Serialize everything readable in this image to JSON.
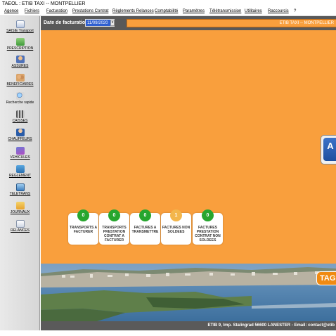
{
  "window": {
    "title": "TAEOL : ETIB TAXI -- MONTPELLIER"
  },
  "menu": [
    "Agence",
    "Fichiers",
    "Facturation",
    "Prestations Contrat",
    "Règlements Relances",
    "Comptabilité",
    "Paramètres",
    "Télétransmission",
    "Utilitaires",
    "Raccourcis",
    "?"
  ],
  "sidebar": [
    {
      "label": "SAISIE Transport",
      "icon": "ambulance-icon"
    },
    {
      "label": "PRESCRIPTION",
      "icon": "prescription-icon"
    },
    {
      "label": "ASSURES",
      "icon": "insured-icon"
    },
    {
      "label": "BENEFICIAIRES",
      "icon": "beneficiaries-icon"
    },
    {
      "label": "Recherche rapide",
      "icon": "quick-search-icon"
    },
    {
      "label": "CAISSES",
      "icon": "cash-register-icon"
    },
    {
      "label": "CHAUFFEURS",
      "icon": "drivers-icon"
    },
    {
      "label": "VEHICULES",
      "icon": "vehicle-icon"
    },
    {
      "label": "REGLEMENT",
      "icon": "payment-icon"
    },
    {
      "label": "TELETRANS",
      "icon": "teletransmission-icon"
    },
    {
      "label": "JOURNAUX",
      "icon": "journals-icon"
    },
    {
      "label": "RELANCES",
      "icon": "reminders-icon"
    }
  ],
  "header": {
    "date_label": "Date de facturation",
    "date_value": "11/09/2020",
    "banner_text": "ETIB TAXI -- MONTPELLIER"
  },
  "cards": [
    {
      "count": "0",
      "label": "TRANSPORTS A FACTURER",
      "status": "green"
    },
    {
      "count": "0",
      "label": "TRANSPORTS PRESTATION CONTRAT A FACTURER",
      "status": "green"
    },
    {
      "count": "0",
      "label": "FACTURES A TRANSMETTRE",
      "status": "green"
    },
    {
      "count": "1",
      "label": "FACTURES NON SOLDEES",
      "status": "amber"
    },
    {
      "count": "0",
      "label": "FACTURES PRESTATION CONTRAT NON SOLDEES",
      "status": "green"
    }
  ],
  "right_logo_letter": "A",
  "tag_text": "TAG",
  "footer": "ETIB 9, Imp. Stalingrad 56600 LANESTER - Email: contact@etib",
  "colors": {
    "accent": "#f99f3d",
    "header": "#595959",
    "badge_green": "#27a62e",
    "badge_amber": "#f3b64c"
  }
}
